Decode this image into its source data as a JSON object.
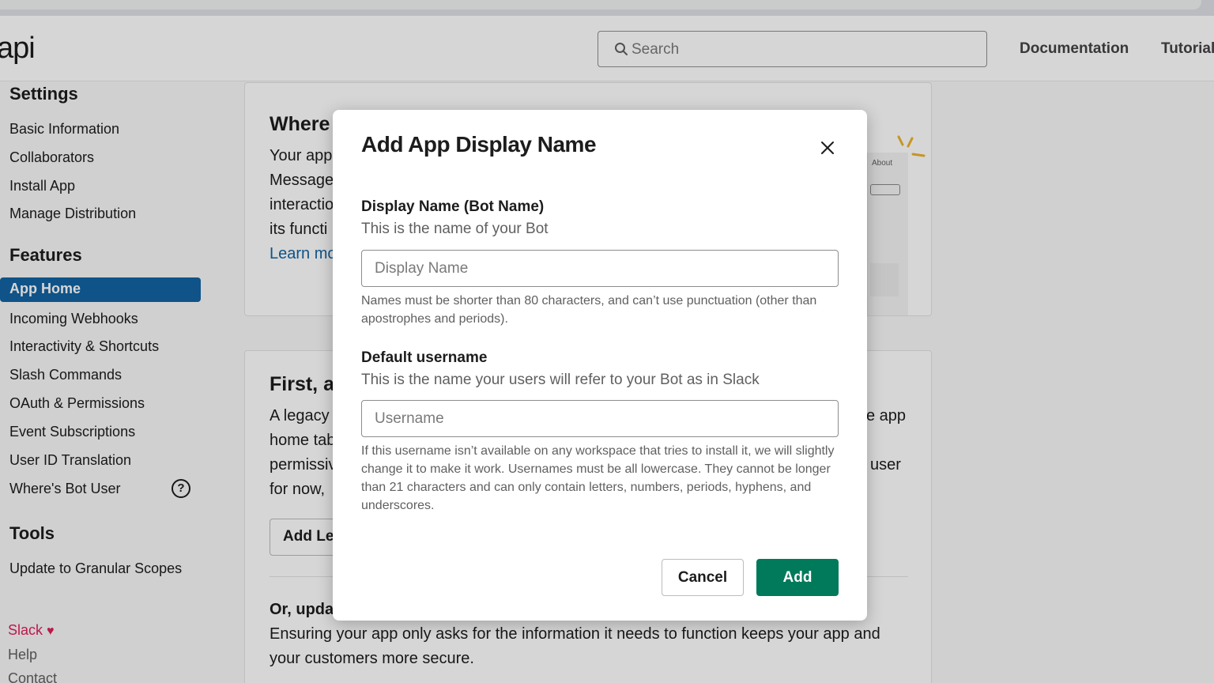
{
  "header": {
    "logo": "api",
    "search_placeholder": "Search",
    "nav": [
      "Documentation",
      "Tutorial"
    ]
  },
  "sidebar": {
    "settings_heading": "Settings",
    "settings_items": [
      "Basic Information",
      "Collaborators",
      "Install App",
      "Manage Distribution"
    ],
    "features_heading": "Features",
    "active_item": "App Home",
    "features_items": [
      "Incoming Webhooks",
      "Interactivity & Shortcuts",
      "Slash Commands",
      "OAuth & Permissions",
      "Event Subscriptions",
      "User ID Translation",
      "Where's Bot User"
    ],
    "help_glyph": "?",
    "tools_heading": "Tools",
    "tools_items": [
      "Update to Granular Scopes"
    ],
    "footer": {
      "slack": "Slack",
      "heart": "♥",
      "help": "Help",
      "contact": "Contact"
    }
  },
  "main": {
    "card1": {
      "title": "Where",
      "lines": [
        "Your app",
        "Message",
        "interactio",
        "its functi"
      ],
      "link": "Learn mo",
      "preview_label": "About"
    },
    "card2": {
      "title": "First, a",
      "lines": [
        "A legacy",
        "home tab",
        "permissiv",
        "for now,"
      ],
      "right_lines": [
        "e app",
        "user"
      ],
      "button": "Add Leg",
      "subtitle": "Or, upda",
      "body": [
        "Ensuring your app only asks for the information it needs to function keeps your app and",
        "your customers more secure."
      ]
    }
  },
  "modal": {
    "title": "Add App Display Name",
    "display_name": {
      "label": "Display Name (Bot Name)",
      "sub": "This is the name of your Bot",
      "placeholder": "Display Name",
      "hint": "Names must be shorter than 80 characters, and can’t use punctuation (other than apostrophes and periods)."
    },
    "username": {
      "label": "Default username",
      "sub": "This is the name your users will refer to your Bot as in Slack",
      "placeholder": "Username",
      "hint": "If this username isn’t available on any workspace that tries to install it, we will slightly change it to make it work. Usernames must be all lowercase. They cannot be longer than 21 characters and can only contain letters, numbers, periods, hyphens, and underscores."
    },
    "cancel_label": "Cancel",
    "add_label": "Add"
  },
  "colors": {
    "primary_button": "#007a5a",
    "active_nav": "#1264a3",
    "link": "#1264a3",
    "slack_brand": "#e01e5a"
  }
}
